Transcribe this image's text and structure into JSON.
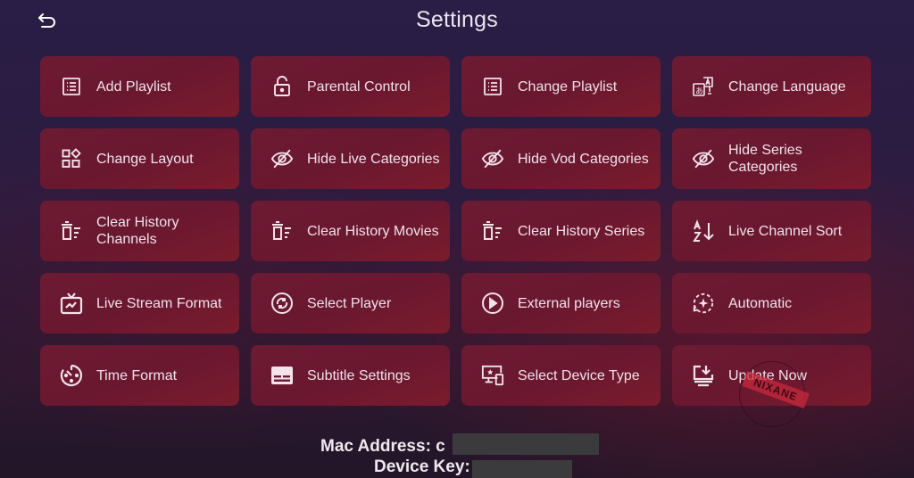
{
  "header": {
    "back_icon": "back-arrow-icon",
    "title": "Settings"
  },
  "colors": {
    "tile_bg": "#6d1a33",
    "background_top": "#2a1d46",
    "background_bottom": "#221628",
    "text": "#efe3e8"
  },
  "tiles": [
    {
      "label": "Add Playlist",
      "icon": "playlist-icon"
    },
    {
      "label": "Parental Control",
      "icon": "lock-icon"
    },
    {
      "label": "Change Playlist",
      "icon": "playlist-icon"
    },
    {
      "label": "Change Language",
      "icon": "translate-icon"
    },
    {
      "label": "Change Layout",
      "icon": "layout-icon"
    },
    {
      "label": "Hide Live Categories",
      "icon": "eye-off-icon"
    },
    {
      "label": "Hide Vod Categories",
      "icon": "eye-off-icon"
    },
    {
      "label": "Hide Series Categories",
      "icon": "eye-off-icon"
    },
    {
      "label": "Clear History Channels",
      "icon": "delete-list-icon"
    },
    {
      "label": "Clear History Movies",
      "icon": "delete-list-icon"
    },
    {
      "label": "Clear History Series",
      "icon": "delete-list-icon"
    },
    {
      "label": "Live Channel Sort",
      "icon": "sort-az-icon"
    },
    {
      "label": "Live Stream Format",
      "icon": "tv-icon"
    },
    {
      "label": "Select Player",
      "icon": "player-switch-icon"
    },
    {
      "label": "External players",
      "icon": "play-circle-icon"
    },
    {
      "label": "Automatic",
      "icon": "auto-refresh-icon"
    },
    {
      "label": "Time Format",
      "icon": "timer-icon"
    },
    {
      "label": "Subtitle Settings",
      "icon": "subtitles-icon"
    },
    {
      "label": "Select Device Type",
      "icon": "devices-icon"
    },
    {
      "label": "Update Now",
      "icon": "download-icon"
    }
  ],
  "footer": {
    "mac_label": "Mac Address: c",
    "device_key_label": "Device Key:"
  },
  "watermark": "NIXANE"
}
